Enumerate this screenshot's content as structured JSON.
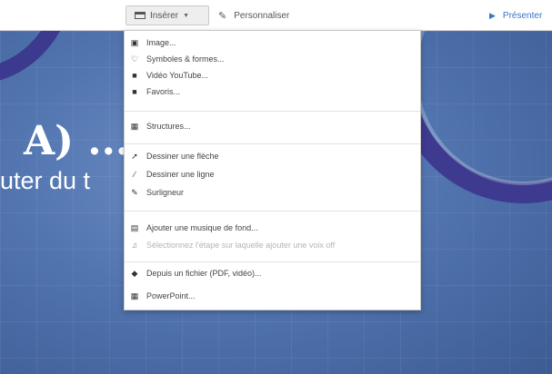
{
  "toolbar": {
    "insert_label": "Insérer",
    "customize_label": "Personnaliser",
    "present_label": "Présenter"
  },
  "slide": {
    "title": "A) ...",
    "subtitle": "uter du t"
  },
  "insert_menu": {
    "items": [
      {
        "label": "Image...",
        "icon": "image-icon",
        "glyph": "▣"
      },
      {
        "label": "Symboles & formes...",
        "icon": "shapes-icon",
        "glyph": "♡"
      },
      {
        "label": "Vidéo YouTube...",
        "icon": "video-icon",
        "glyph": "■"
      },
      {
        "label": "Favoris...",
        "icon": "favorites-icon",
        "glyph": "■"
      },
      {
        "label": "Structures...",
        "icon": "structures-icon",
        "glyph": "▦"
      },
      {
        "label": "Dessiner une flèche",
        "icon": "arrow-draw-icon",
        "glyph": "➚"
      },
      {
        "label": "Dessiner une ligne",
        "icon": "line-draw-icon",
        "glyph": "∕"
      },
      {
        "label": "Surligneur",
        "icon": "highlighter-icon",
        "glyph": "✎"
      },
      {
        "label": "Ajouter une musique de fond...",
        "icon": "music-icon",
        "glyph": "▤"
      },
      {
        "label": "Sélectionnez l'étape sur laquelle ajouter une voix off",
        "icon": "voiceover-icon",
        "glyph": "♫"
      },
      {
        "label": "Depuis un fichier (PDF, vidéo)...",
        "icon": "file-import-icon",
        "glyph": "◆"
      },
      {
        "label": "PowerPoint...",
        "icon": "powerpoint-icon",
        "glyph": "▦"
      }
    ]
  }
}
